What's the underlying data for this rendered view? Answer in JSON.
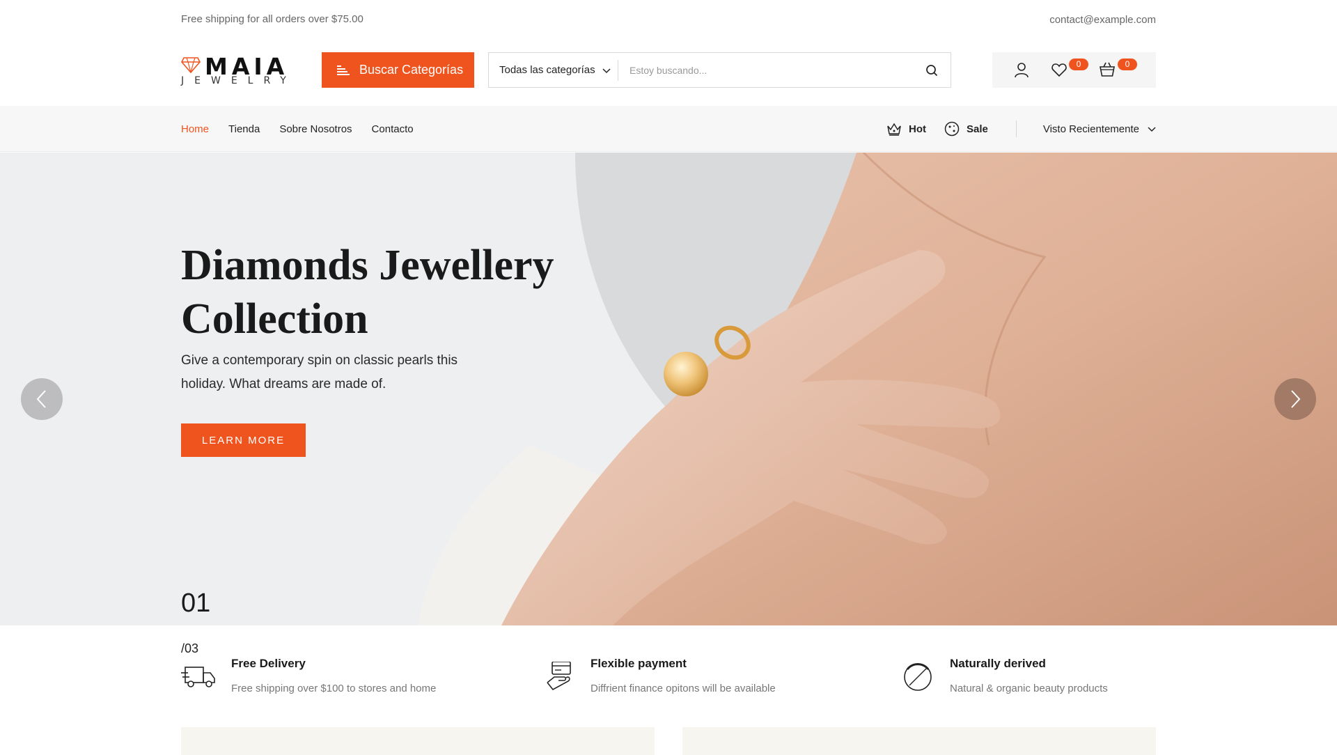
{
  "topbar": {
    "shipping": "Free shipping for all orders over $75.00",
    "email": "contact@example.com"
  },
  "brand": {
    "name": "MAIA",
    "tagline": "JEWELRY",
    "accent": "#f0541e"
  },
  "header": {
    "categories_button": "Buscar Categorías",
    "search_category": "Todas las categorías",
    "search_placeholder": "Estoy buscando...",
    "wishlist_count": "0",
    "cart_count": "0"
  },
  "nav": {
    "links": [
      "Home",
      "Tienda",
      "Sobre Nosotros",
      "Contacto"
    ],
    "active": "Home",
    "hot": "Hot",
    "sale": "Sale",
    "recent": "Visto Recientemente"
  },
  "hero": {
    "title_line1": "Diamonds Jewellery",
    "title_line2": "Collection",
    "subtitle": "Give a contemporary spin on classic pearls this holiday. What dreams are made of.",
    "cta": "LEARN MORE",
    "slide_current": "01",
    "slide_total": "/03"
  },
  "features": [
    {
      "icon": "delivery-truck-icon",
      "title": "Free Delivery",
      "desc": "Free shipping over $100 to stores and home"
    },
    {
      "icon": "payment-hand-icon",
      "title": "Flexible payment",
      "desc": "Diffrient finance opitons will be available"
    },
    {
      "icon": "24-7-support-icon",
      "title": "Naturally derived",
      "desc": "Natural & organic beauty products"
    }
  ]
}
